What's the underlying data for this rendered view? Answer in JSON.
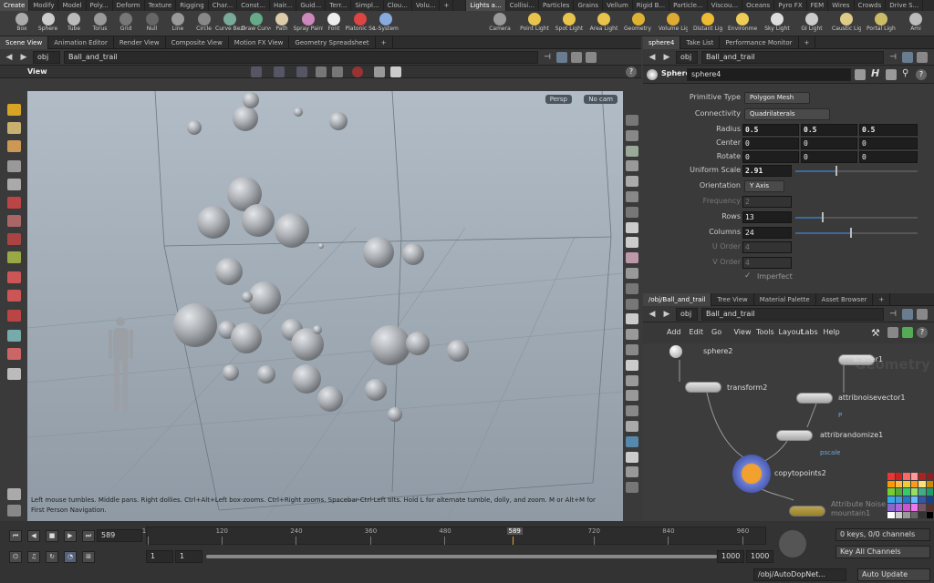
{
  "shelf": {
    "tabs": [
      "Create",
      "Modify",
      "Model",
      "Poly...",
      "Deform",
      "Texture",
      "Rigging",
      "Char...",
      "Const...",
      "Hair...",
      "Guid...",
      "Terr...",
      "Simpl...",
      "Clou...",
      "Volu...",
      "+"
    ],
    "tabs_right": [
      "Lights a...",
      "Collisi...",
      "Particles",
      "Grains",
      "Vellum",
      "Rigid B...",
      "Particle...",
      "Viscou...",
      "Oceans",
      "Pyro FX",
      "FEM",
      "Wires",
      "Crowds",
      "Drive S..."
    ],
    "tools": [
      "Box",
      "Sphere",
      "Tube",
      "Torus",
      "Grid",
      "Null",
      "Line",
      "Circle",
      "Curve Bezier",
      "Draw Curve",
      "Path",
      "Spray Paint",
      "Font",
      "Platonic Solids",
      "L-System"
    ],
    "lights": [
      "Camera",
      "Point Light",
      "Spot Light",
      "Area Light",
      "Geometry Light",
      "Volume Light",
      "Distant Light",
      "Environment Light",
      "Sky Light",
      "GI Light",
      "Caustic Light",
      "Portal Light",
      "Ami"
    ]
  },
  "left_pane": {
    "tabs": [
      "Scene View",
      "Animation Editor",
      "Render View",
      "Composite View",
      "Motion FX View",
      "Geometry Spreadsheet",
      "+"
    ],
    "path": {
      "root": "obj",
      "node": "Ball_and_trail"
    },
    "view_label": "View",
    "persp": "Persp",
    "cam": "No cam",
    "help_text": "Left mouse tumbles. Middle pans. Right dollies. Ctrl+Alt+Left box-zooms. Ctrl+Right zooms. Spacebar-Ctrl-Left tilts. Hold L for alternate tumble, dolly, and zoom.     M or Alt+M for First Person Navigation."
  },
  "right_pane": {
    "tabs": [
      "sphere4",
      "Take List",
      "Performance Monitor",
      "+"
    ],
    "path": {
      "root": "obj",
      "node": "Ball_and_trail"
    },
    "node_type": "Sphere",
    "node_name": "sphere4",
    "params": {
      "primitive_type": {
        "label": "Primitive Type",
        "value": "Polygon Mesh"
      },
      "connectivity": {
        "label": "Connectivity",
        "value": "Quadrilaterals"
      },
      "radius": {
        "label": "Radius",
        "x": "0.5",
        "y": "0.5",
        "z": "0.5"
      },
      "center": {
        "label": "Center",
        "x": "0",
        "y": "0",
        "z": "0"
      },
      "rotate": {
        "label": "Rotate",
        "x": "0",
        "y": "0",
        "z": "0"
      },
      "uniform_scale": {
        "label": "Uniform Scale",
        "value": "2.91",
        "level": 0.33
      },
      "orientation": {
        "label": "Orientation",
        "value": "Y Axis"
      },
      "frequency": {
        "label": "Frequency",
        "value": "2"
      },
      "rows": {
        "label": "Rows",
        "value": "13",
        "level": 0.22
      },
      "columns": {
        "label": "Columns",
        "value": "24",
        "level": 0.45
      },
      "u_order": {
        "label": "U Order",
        "value": "4"
      },
      "v_order": {
        "label": "V Order",
        "value": "4"
      },
      "imperfect": {
        "label": "Imperfect"
      }
    }
  },
  "network": {
    "tabs": [
      "/obj/Ball_and_trail",
      "Tree View",
      "Material Palette",
      "Asset Browser",
      "+"
    ],
    "path": {
      "root": "obj",
      "node": "Ball_and_trail"
    },
    "menu": [
      "Add",
      "Edit",
      "Go",
      "View",
      "Tools",
      "Layout",
      "Labs",
      "Help"
    ],
    "watermark": "Geometry",
    "nodes": {
      "sphere2": "sphere2",
      "transform2": "transform2",
      "scatter1": "scatter1",
      "attribnoisevector1": "attribnoisevector1",
      "attribnoisevector1_sub": "P",
      "attribrandomize1": "attribrandomize1",
      "attribrandomize1_sub": "pscale",
      "copytopoints2": "copytopoints2",
      "attribute_noise": "Attribute Noise",
      "mountain1": "mountain1"
    }
  },
  "timeline": {
    "frame": "589",
    "ticks": [
      "1",
      "120",
      "240",
      "360",
      "480",
      "589",
      "720",
      "840",
      "960"
    ],
    "start": "1",
    "start2": "1",
    "end": "1000",
    "end2": "1000",
    "keys": "0 keys, 0/0 channels",
    "key_all": "Key All Channels",
    "path": "/obj/AutoDopNet...",
    "auto_update": "Auto Update"
  },
  "colors": {
    "accent": "#f0a030",
    "blue": "#3b6a9c",
    "selected_node": "#f2a12e"
  }
}
